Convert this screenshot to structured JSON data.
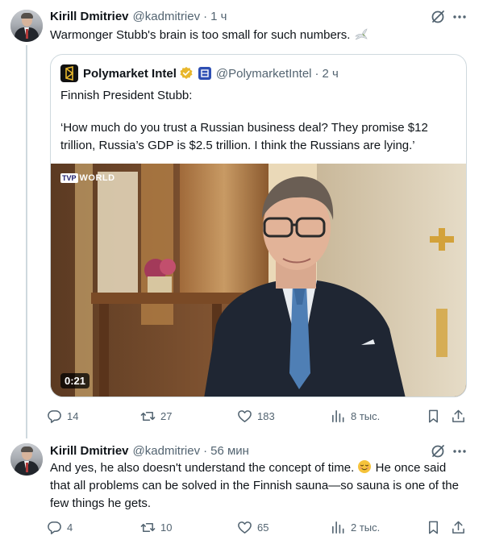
{
  "tweet1": {
    "author_name": "Kirill Dmitriev",
    "handle": "@kadmitriev",
    "separator": "·",
    "time": "1 ч",
    "text": "Warmonger Stubb's brain is too small for such numbers.",
    "emoji_icon": "dove-icon",
    "quoted": {
      "name": "Polymarket Intel",
      "handle": "@PolymarketIntel",
      "separator": "·",
      "time": "2 ч",
      "text_line1": "Finnish President Stubb:",
      "text_line2": "‘How much do you trust a Russian business deal? They promise $12 trillion, Russia’s GDP is $2.5 trillion. I think the Russians are lying.’",
      "media": {
        "channel_logo_box": "TVP",
        "channel_logo_word": "WORLD",
        "duration": "0:21"
      }
    },
    "stats": {
      "replies": "14",
      "retweets": "27",
      "likes": "183",
      "views": "8 тыс."
    }
  },
  "tweet2": {
    "author_name": "Kirill Dmitriev",
    "handle": "@kadmitriev",
    "separator": "·",
    "time": "56 мин",
    "text_part1": "And yes, he also doesn't understand the concept of time.",
    "text_part2": "He once said that all problems can be solved in the Finnish sauna—so sauna is one of the few things he gets.",
    "emoji_icon": "relieved-face-icon",
    "stats": {
      "replies": "4",
      "retweets": "10",
      "likes": "65",
      "views": "2 тыс."
    }
  },
  "colors": {
    "text_primary": "#0f1419",
    "text_secondary": "#536471",
    "border": "#cfd9de",
    "verified_gold": "#e8b72c",
    "affiliate_blue": "#2e4fb3"
  }
}
